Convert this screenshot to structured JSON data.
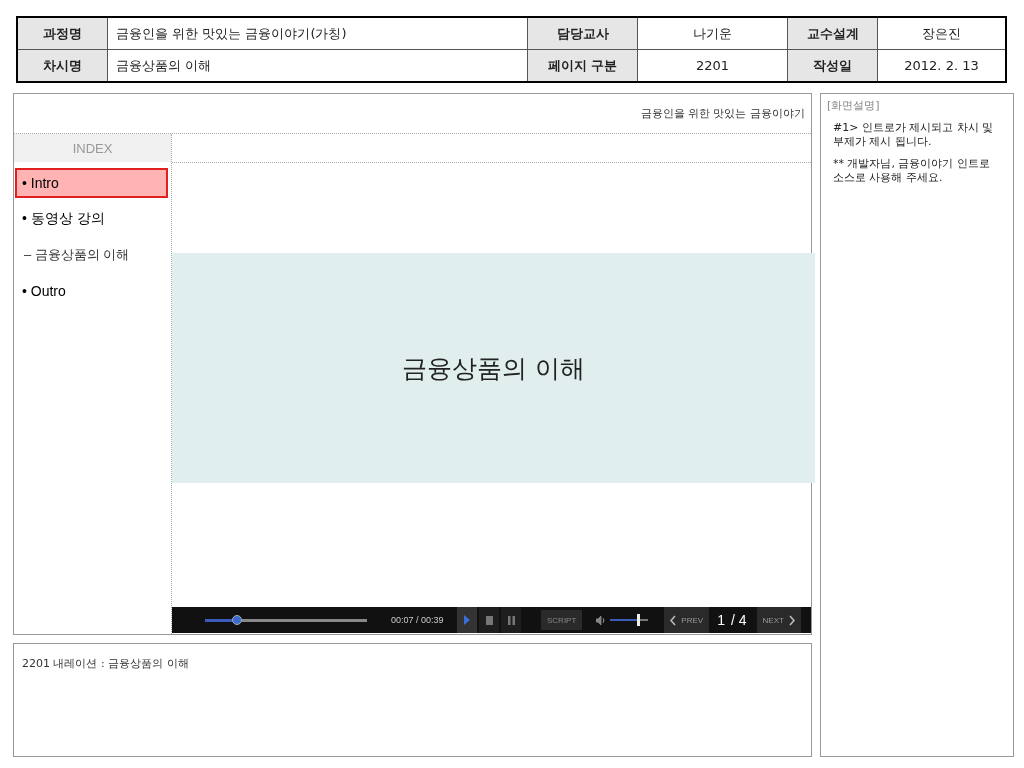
{
  "header": {
    "rows": [
      {
        "cells": [
          {
            "kind": "label",
            "text": "과정명"
          },
          {
            "kind": "value",
            "text": "금융인을 위한 맛있는 금융이야기(가칭)"
          },
          {
            "kind": "label",
            "text": "담당교사"
          },
          {
            "kind": "center",
            "text": "나기운"
          },
          {
            "kind": "label",
            "text": "교수설계"
          },
          {
            "kind": "center",
            "text": "장은진"
          }
        ]
      },
      {
        "cells": [
          {
            "kind": "label",
            "text": "차시명"
          },
          {
            "kind": "value",
            "text": "금융상품의 이해"
          },
          {
            "kind": "label",
            "text": "페이지 구분"
          },
          {
            "kind": "center",
            "text": "2201"
          },
          {
            "kind": "label",
            "text": "작성일"
          },
          {
            "kind": "center",
            "text": "2012. 2. 13"
          }
        ]
      }
    ]
  },
  "course_title": "금융인을 위한 맛있는 금융이야기",
  "index": {
    "title": "INDEX",
    "items": [
      {
        "label": "• Intro",
        "selected": true
      },
      {
        "label": "• 동영상 강의",
        "selected": false,
        "children": [
          {
            "label": "– 금융상품의 이해",
            "selected": false
          }
        ]
      },
      {
        "label": "• Outro",
        "selected": false
      }
    ]
  },
  "banner": {
    "title": "금융상품의 이해"
  },
  "player": {
    "progress": {
      "level": 0.2
    },
    "time": "00:07 / 00:39",
    "controls": [
      {
        "kind": "play",
        "selected": true
      },
      {
        "kind": "stop",
        "selected": false
      },
      {
        "kind": "pause",
        "selected": false
      }
    ],
    "script_button": "SCRIPT",
    "volume": {
      "level": 0.75
    },
    "prev": "PREV",
    "page_current": "1",
    "page_total": "/ 4",
    "next": "NEXT"
  },
  "narration": "2201 내레이션 : 금융상품의 이해",
  "description": {
    "title": "[화면설명]",
    "paragraphs": [
      "#1> 인트로가 제시되고 차시 및 부제가 제시 됩니다.",
      "** 개발자님, 금융이야기 인트로 소스로 사용해 주세요."
    ]
  }
}
